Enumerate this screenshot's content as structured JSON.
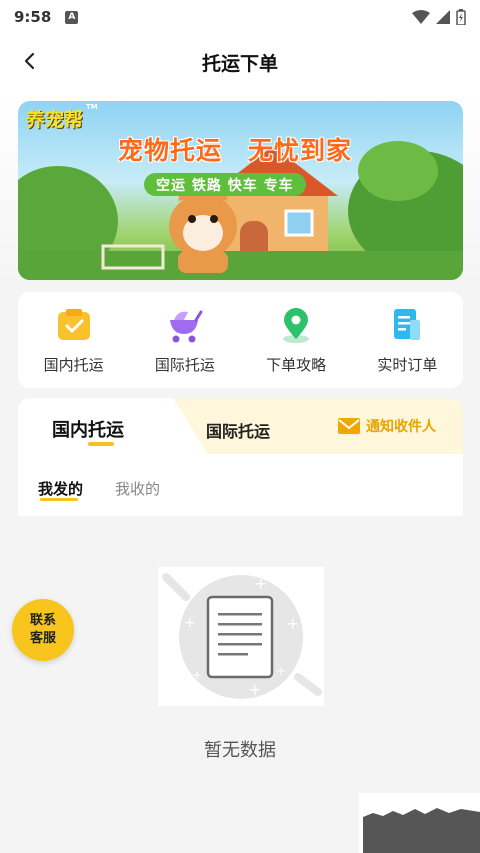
{
  "status_bar": {
    "time": "9:58",
    "notif_badge": "A"
  },
  "nav": {
    "title": "托运下单"
  },
  "banner": {
    "logo_text": "养宠帮",
    "logo_mark": "TM",
    "headline": "宠物托运　无忧到家",
    "modes": "空运 铁路 快车 专车"
  },
  "menu": [
    {
      "label": "国内托运",
      "icon": "clipboard-check-icon",
      "color": "#f8c22d"
    },
    {
      "label": "国际托运",
      "icon": "pet-stroller-icon",
      "color": "#a06bf0"
    },
    {
      "label": "下单攻略",
      "icon": "location-pin-icon",
      "color": "#2cc16b"
    },
    {
      "label": "实时订单",
      "icon": "document-icon",
      "color": "#2fb8f0"
    }
  ],
  "tabs": {
    "domestic": "国内托运",
    "international": "国际托运",
    "notify": "通知收件人",
    "sub_sent": "我发的",
    "sub_received": "我收的"
  },
  "empty": {
    "text": "暂无数据"
  },
  "service": {
    "line1": "联系",
    "line2": "客服"
  },
  "colors": {
    "accent": "#f6c21c",
    "notify_text": "#e9a400",
    "background": "#f4f4f4"
  }
}
